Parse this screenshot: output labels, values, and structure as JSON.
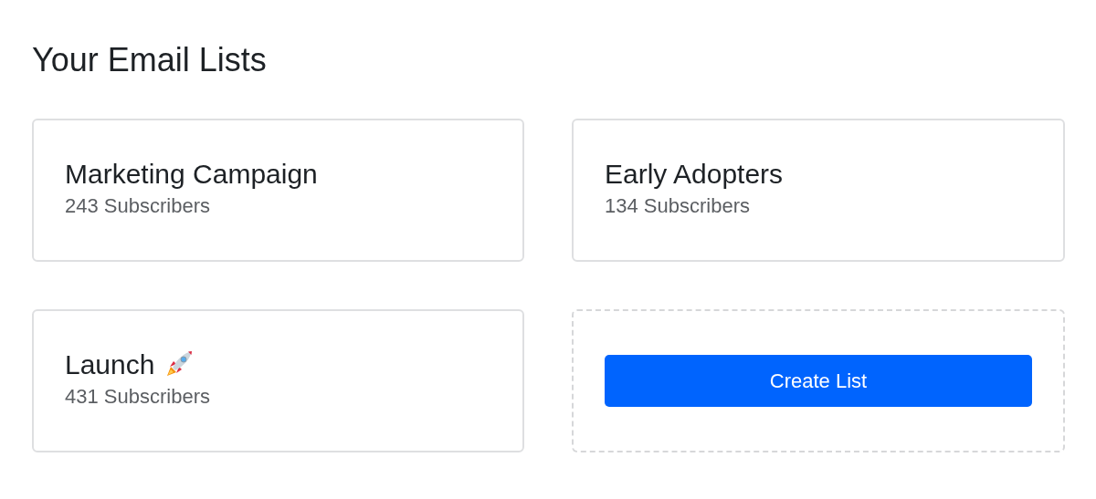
{
  "heading": "Your Email Lists",
  "lists": [
    {
      "name": "Marketing Campaign",
      "count": "243 Subscribers",
      "icon": false
    },
    {
      "name": "Early Adopters",
      "count": "134 Subscribers",
      "icon": false
    },
    {
      "name": "Launch",
      "count": "431 Subscribers",
      "icon": true
    }
  ],
  "create_button": "Create List"
}
